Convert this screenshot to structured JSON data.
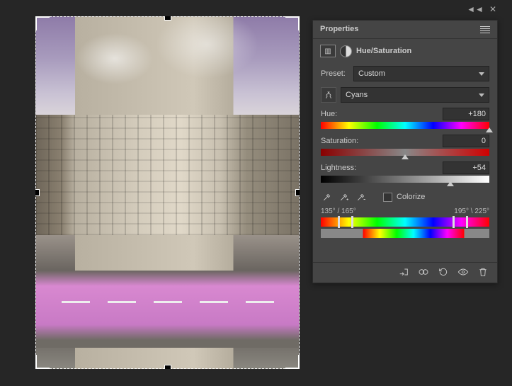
{
  "panel": {
    "title": "Properties",
    "adjustment_name": "Hue/Saturation",
    "preset_label": "Preset:",
    "preset_value": "Custom",
    "channel_value": "Cyans",
    "sliders": {
      "hue": {
        "label": "Hue:",
        "value": "+180",
        "pos": 100
      },
      "saturation": {
        "label": "Saturation:",
        "value": "0",
        "pos": 50
      },
      "lightness": {
        "label": "Lightness:",
        "value": "+54",
        "pos": 77
      }
    },
    "colorize_label": "Colorize",
    "range_labels": {
      "left": "135° /  165°",
      "right": "195° \\ 225°"
    },
    "footer_icons": [
      "clip-to-layer",
      "mask-toggle",
      "reset",
      "visibility",
      "trash"
    ]
  }
}
